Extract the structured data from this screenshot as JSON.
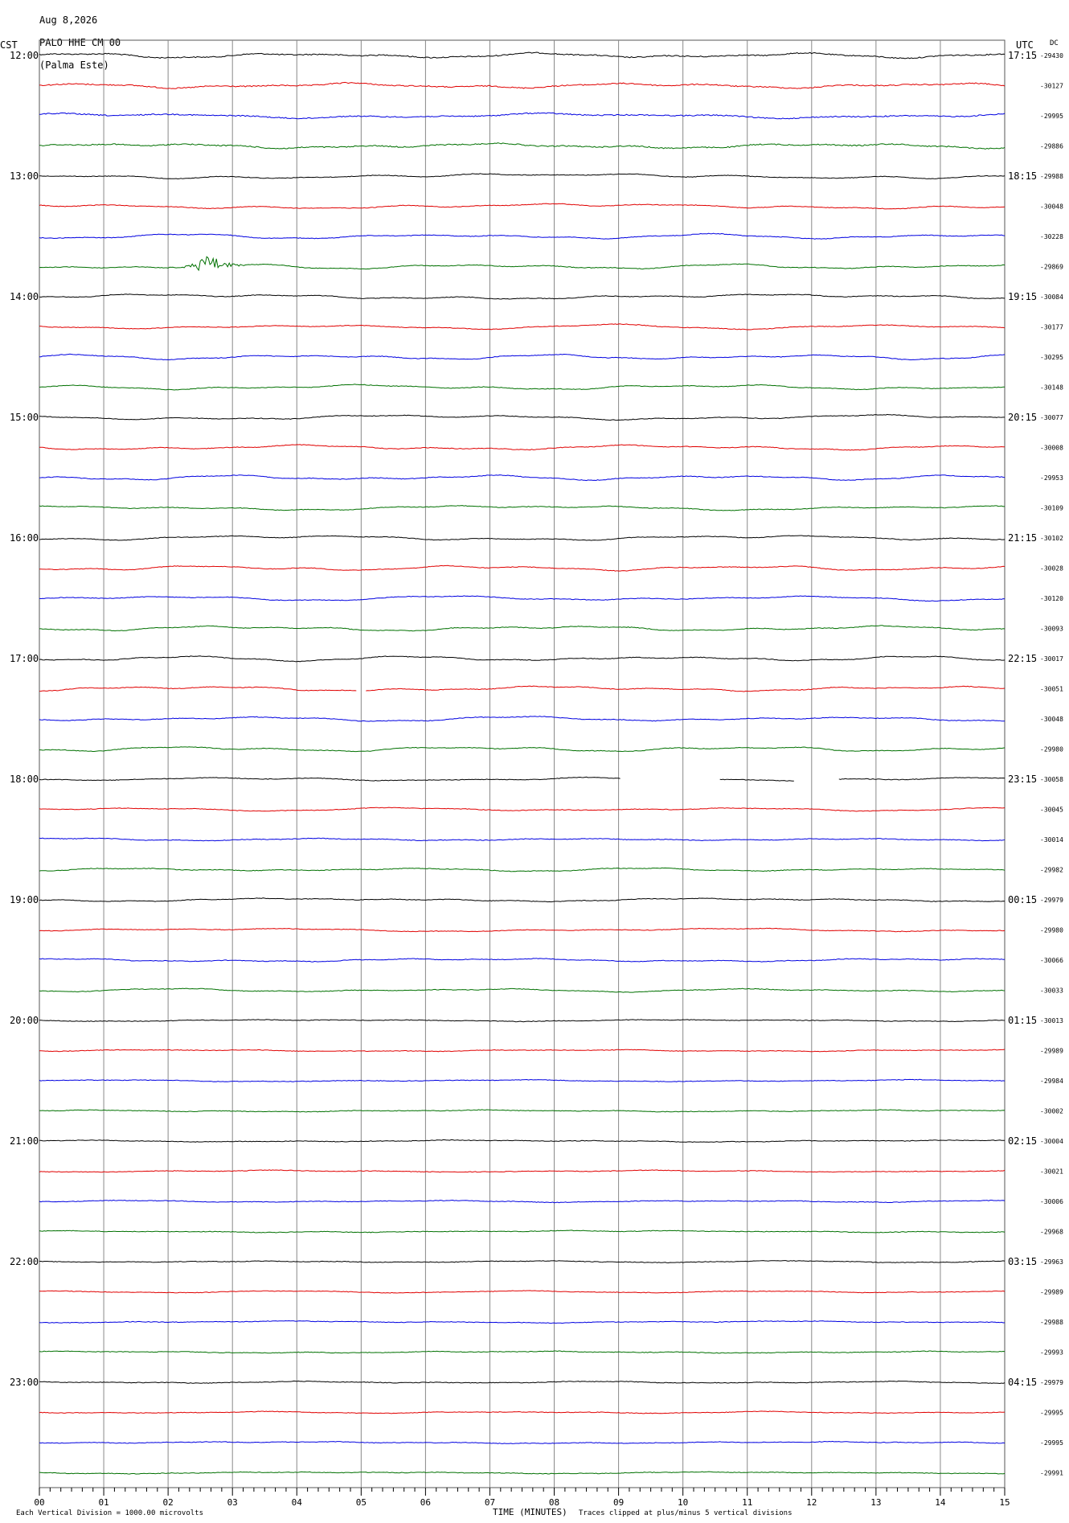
{
  "header": {
    "date": "Aug 8,2026",
    "station": "PALO HHE CM 00",
    "site": "(Palma Este)"
  },
  "timezones": {
    "left": "CST",
    "right": "UTC",
    "dc": "DC"
  },
  "trace_colors": [
    "#000000",
    "#e00000",
    "#0000e0",
    "#007000"
  ],
  "footer": {
    "scale_note": "Each Vertical Division = 1000.00 microvolts",
    "xlabel": "TIME (MINUTES)",
    "clip_note": "Traces clipped at plus/minus 5 vertical divisions"
  },
  "chart_data": {
    "type": "line",
    "title": "",
    "xlabel": "TIME (MINUTES)",
    "x_ticks": [
      "00",
      "01",
      "02",
      "03",
      "04",
      "05",
      "06",
      "07",
      "08",
      "09",
      "10",
      "11",
      "12",
      "13",
      "14",
      "15"
    ],
    "xlim": [
      0,
      15
    ],
    "grid": true,
    "rows_per_hour": 4,
    "left_hour_labels": [
      "12:00",
      "13:00",
      "14:00",
      "15:00",
      "16:00",
      "17:00",
      "18:00",
      "19:00",
      "20:00",
      "21:00",
      "22:00",
      "23:00"
    ],
    "right_hour_labels": [
      "17:15",
      "18:15",
      "19:15",
      "20:15",
      "21:15",
      "22:15",
      "23:15",
      "00:15",
      "01:15",
      "02:15",
      "03:15",
      "04:15"
    ],
    "dc_offsets": [
      "-29430",
      "-30127",
      "-29995",
      "-29886",
      "-29988",
      "-30048",
      "-30228",
      "-29869",
      "-30084",
      "-30177",
      "-30295",
      "-30148",
      "-30077",
      "-30008",
      "-29953",
      "-30109",
      "-30102",
      "-30028",
      "-30120",
      "-30093",
      "-30017",
      "-30051",
      "-30048",
      "-29980",
      "-30058",
      "-30045",
      "-30014",
      "-29982",
      "-29979",
      "-29980",
      "-30066",
      "-30033",
      "-30013",
      "-29989",
      "-29984",
      "-30002",
      "-30004",
      "-30021",
      "-30006",
      "-29968",
      "-29963",
      "-29989",
      "-29988",
      "-29993",
      "-29979",
      "-29995",
      "-29995",
      "-29991"
    ],
    "events": [
      {
        "row": 7,
        "minute": 2.65,
        "description": "burst"
      }
    ],
    "gaps": [
      {
        "row": 21,
        "start": 4.95,
        "end": 5.05
      },
      {
        "row": 24,
        "start": 9.05,
        "end": 10.55
      },
      {
        "row": 24,
        "start": 11.75,
        "end": 12.4
      }
    ]
  }
}
